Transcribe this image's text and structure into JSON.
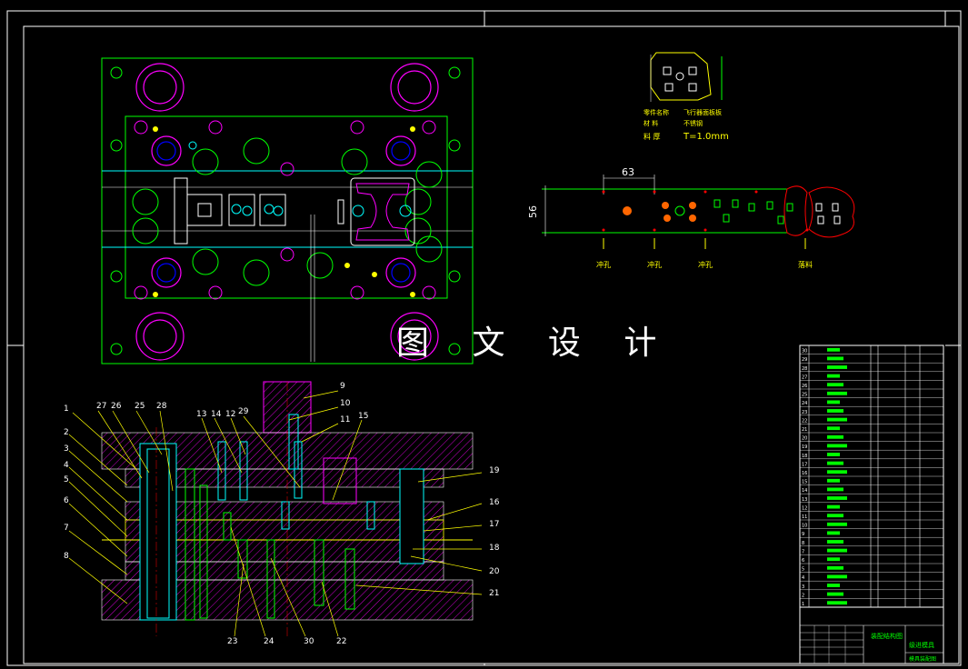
{
  "watermark": "图 文 设 计",
  "colors": {
    "border": "#ffffff",
    "plate": "#00ff00",
    "magenta": "#ff00ff",
    "cyan": "#00ffff",
    "yellow": "#ffff00",
    "red": "#ff0000",
    "leader": "#ffff00",
    "hatch": "#ff00ff"
  },
  "part": {
    "name_label": "零件名称",
    "name_value": "飞行器面板板",
    "material_label": "材    料",
    "material_value": "不锈钢",
    "thickness_label": "料    厚",
    "thickness_value": "T=1.0mm"
  },
  "strip": {
    "dim_pitch": "63",
    "dim_width": "56",
    "station_labels": [
      "冲孔",
      "冲孔",
      "冲孔",
      "落料"
    ]
  },
  "callouts": {
    "left": [
      "1",
      "27",
      "26",
      "25",
      "28",
      "2",
      "3",
      "4",
      "5",
      "6",
      "7",
      "8"
    ],
    "top": [
      "13",
      "14",
      "12",
      "29",
      "9",
      "10",
      "11",
      "15"
    ],
    "right": [
      "19",
      "16",
      "17",
      "18",
      "20",
      "21"
    ],
    "bottom": [
      "23",
      "24",
      "30",
      "22"
    ]
  },
  "bom_rows": [
    "30",
    "29",
    "28",
    "27",
    "26",
    "25",
    "24",
    "23",
    "22",
    "21",
    "20",
    "19",
    "18",
    "17",
    "16",
    "15",
    "14",
    "13",
    "12",
    "11",
    "10",
    "9",
    "8",
    "7",
    "6",
    "5",
    "4",
    "3",
    "2",
    "1"
  ],
  "title_block": {
    "title": "级进模具",
    "drawing": "装配结构图",
    "sheet": "模具装配图"
  }
}
